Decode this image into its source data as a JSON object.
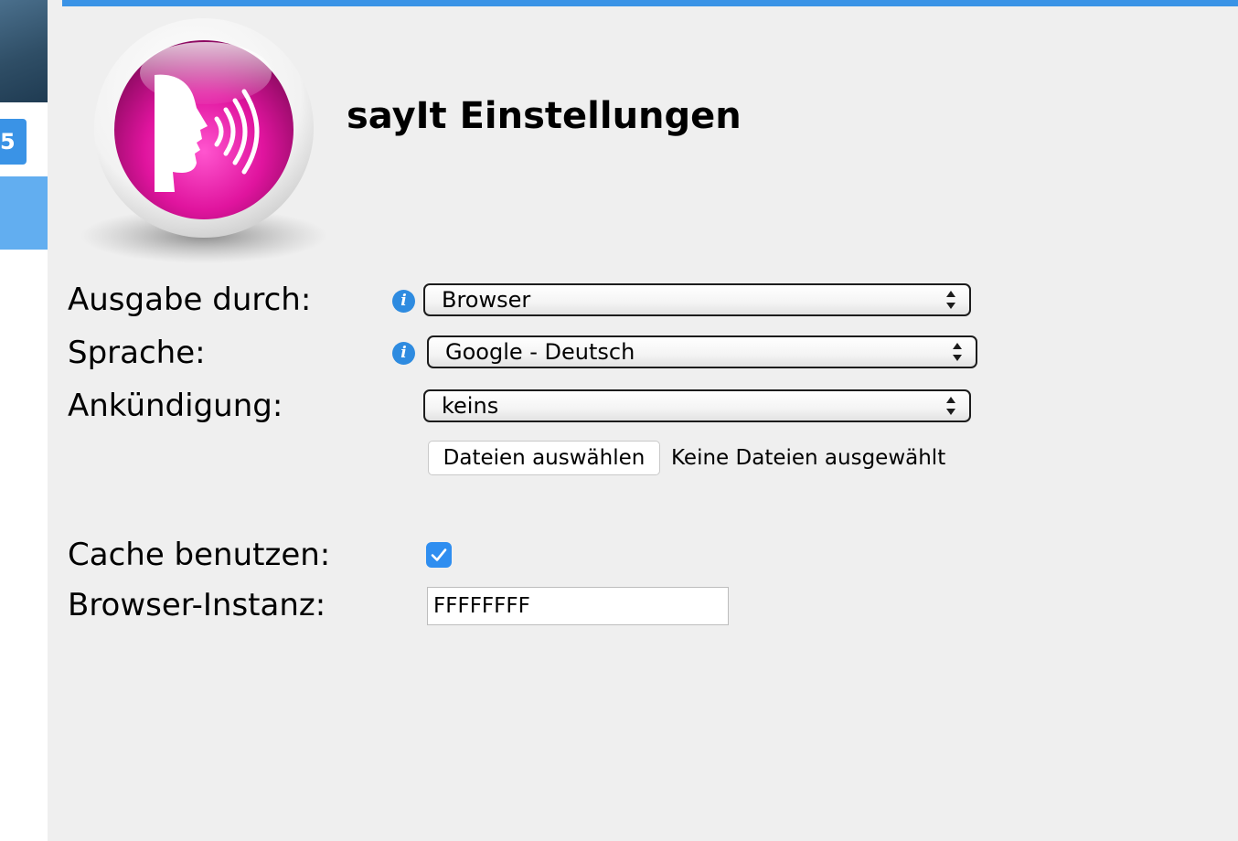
{
  "sidebar": {
    "badge": "5"
  },
  "header": {
    "title": "sayIt Einstellungen",
    "logo_icon": "speaking-head-sound-waves-icon",
    "logo_color": "#e0149e"
  },
  "form": {
    "output": {
      "label": "Ausgabe durch:",
      "value": "Browser"
    },
    "language": {
      "label": "Sprache:",
      "value": "Google - Deutsch"
    },
    "announcement": {
      "label": "Ankündigung:",
      "value": "keins",
      "file_button": "Dateien auswählen",
      "file_status": "Keine Dateien ausgewählt"
    },
    "cache": {
      "label": "Cache benutzen:",
      "checked": true
    },
    "instance": {
      "label": "Browser-Instanz:",
      "value": "FFFFFFFF"
    }
  },
  "colors": {
    "accent": "#3a93e6",
    "info_icon": "#2e8be0",
    "checkbox": "#2f8ef0"
  }
}
